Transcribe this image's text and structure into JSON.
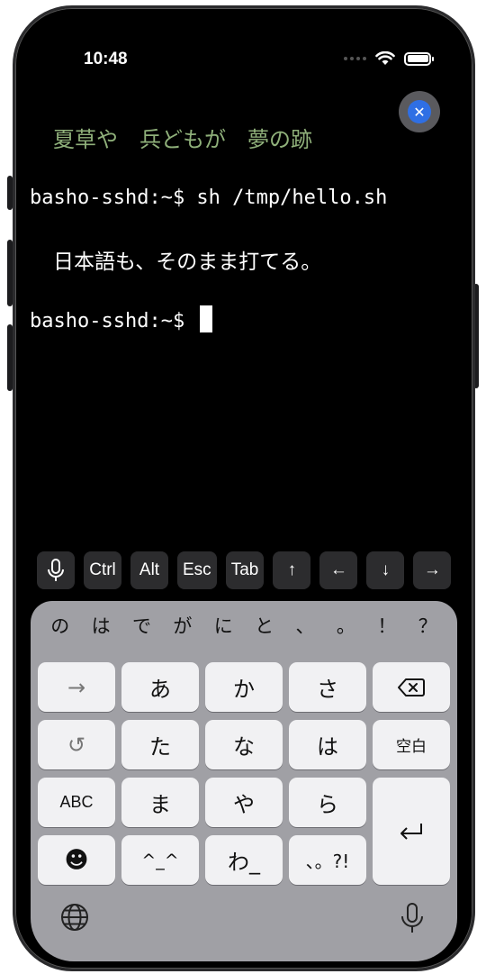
{
  "status_bar": {
    "time": "10:48"
  },
  "terminal": {
    "haiku": "夏草や　兵どもが　夢の跡",
    "lines": [
      "basho-sshd:~$ sh /tmp/hello.sh",
      "日本語も、そのまま打てる。",
      "basho-sshd:~$ "
    ]
  },
  "key_bar": {
    "keys": [
      "Ctrl",
      "Alt",
      "Esc",
      "Tab",
      "↑",
      "←",
      "↓",
      "→"
    ]
  },
  "keyboard": {
    "suggestions": [
      "の",
      "は",
      "で",
      "が",
      "に",
      "と",
      "、",
      "。",
      "！",
      "？"
    ],
    "rows": [
      [
        "→",
        "あ",
        "か",
        "さ",
        "⌫"
      ],
      [
        "↺",
        "た",
        "な",
        "は",
        "空白"
      ],
      [
        "ABC",
        "ま",
        "や",
        "ら"
      ],
      [
        "☻",
        "^_^",
        "わ_",
        "、。?!"
      ]
    ],
    "return_label": "↵"
  },
  "colors": {
    "haiku": "#8fb07a",
    "accent_blue": "#2f6fe4"
  }
}
